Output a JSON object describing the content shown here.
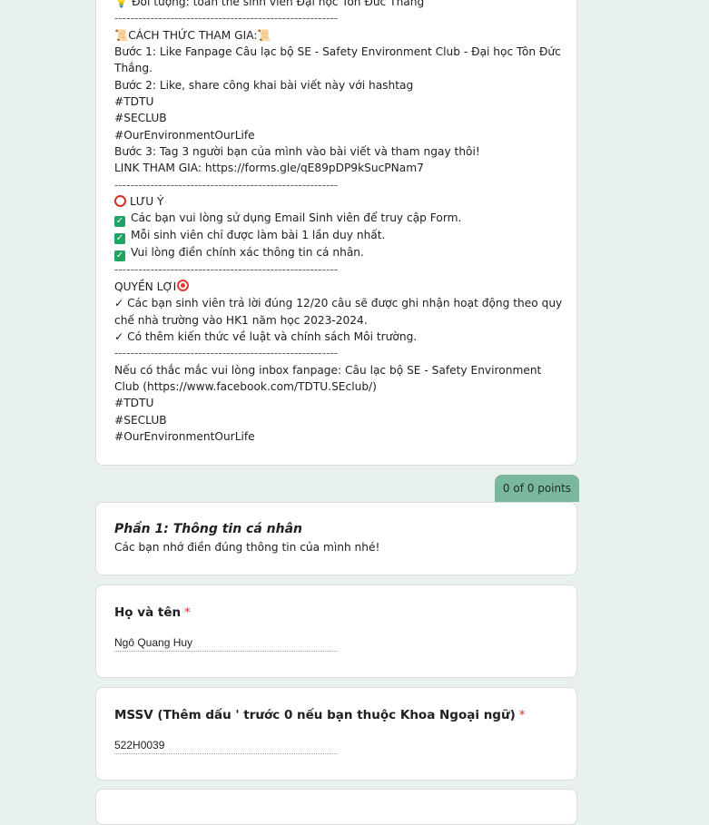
{
  "description": {
    "audience_line": "Đối tượng: toàn thể sinh viên Đại học Tôn Đức Thắng",
    "separator": "--------------------------------------------------------",
    "how_to_join": "CÁCH THỨC THAM GIA:",
    "step1": "Bước 1: Like Fanpage Câu lạc bộ SE - Safety Environment Club - Đại học Tôn Đức Thắng.",
    "step2": "Bước 2: Like, share công khai bài viết này với hashtag",
    "tag1": "#TDTU",
    "tag2": "#SECLUB",
    "tag3": "#OurEnvironmentOurLife",
    "step3": "Bước 3: Tag 3 người bạn của mình vào bài viết và tham ngay thôi!",
    "link": "LINK THAM GIA: https://forms.gle/qE89pDP9kSucPNam7",
    "note_title": "LƯU Ý",
    "note1": "Các bạn vui lòng sử dụng Email Sinh viên để truy cập Form.",
    "note2": "Mỗi sinh viên chỉ được làm bài 1 lần duy nhất.",
    "note3": "Vui lòng điền chính xác thông tin cá nhân.",
    "benefits_title": "QUYỀN LỢI",
    "benefit1": "✓ Các bạn sinh viên trả lời đúng 12/20 câu sẽ được ghi nhận hoạt động theo quy chế nhà trường vào HK1 năm học 2023-2024.",
    "benefit2": "✓ Có thêm kiến thức về luật và chính sách Môi trường.",
    "contact": "Nếu có thắc mắc vui lòng inbox fanpage: Câu lạc bộ SE - Safety Environment Club (https://www.facebook.com/TDTU.SEclub/)",
    "end_tag1": "#TDTU",
    "end_tag2": "#SECLUB",
    "end_tag3": "#OurEnvironmentOurLife"
  },
  "points_badge": "0 of 0 points",
  "section": {
    "title": "Phần 1: Thông tin cá nhân",
    "description": "Các bạn nhớ điền đúng thông tin của mình nhé!"
  },
  "questions": [
    {
      "title": "Họ và tên",
      "required_mark": "*",
      "answer": "Ngô Quang Huy"
    },
    {
      "title": "MSSV (Thêm dấu ' trước 0 nếu bạn thuộc Khoa Ngoại ngữ)",
      "required_mark": "*",
      "answer": "522H0039"
    }
  ],
  "colors": {
    "background": "#e9f1ee",
    "accent_tab": "#7ab89e",
    "required": "#d93025",
    "checkbox": "#1ea362"
  }
}
